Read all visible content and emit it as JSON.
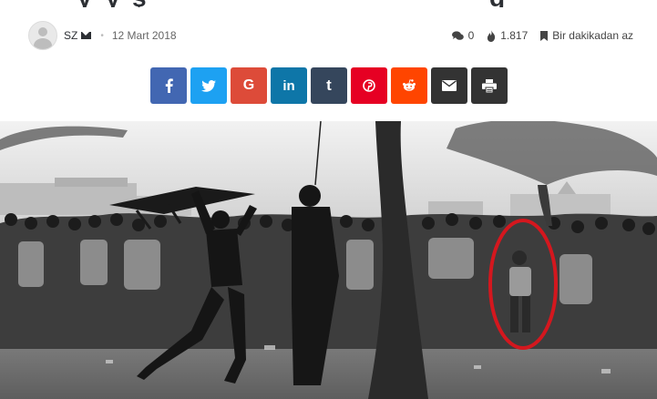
{
  "article": {
    "author": "SZ",
    "date": "12 Mart 2018",
    "comments": "0",
    "views": "1.817",
    "read_time": "Bir dakikadan az"
  },
  "share_buttons": [
    {
      "name": "facebook",
      "color": "#4267b2",
      "icon": "facebook-icon"
    },
    {
      "name": "twitter",
      "color": "#1da1f2",
      "icon": "twitter-icon"
    },
    {
      "name": "google",
      "color": "#dd4b39",
      "icon": "google-icon"
    },
    {
      "name": "linkedin",
      "color": "#0e76a8",
      "icon": "linkedin-icon"
    },
    {
      "name": "tumblr",
      "color": "#35465c",
      "icon": "tumblr-icon"
    },
    {
      "name": "pinterest",
      "color": "#e60023",
      "icon": "pinterest-icon"
    },
    {
      "name": "reddit",
      "color": "#ff4500",
      "icon": "reddit-icon"
    },
    {
      "name": "email",
      "color": "#333333",
      "icon": "envelope-icon"
    },
    {
      "name": "print",
      "color": "#333333",
      "icon": "print-icon"
    }
  ]
}
